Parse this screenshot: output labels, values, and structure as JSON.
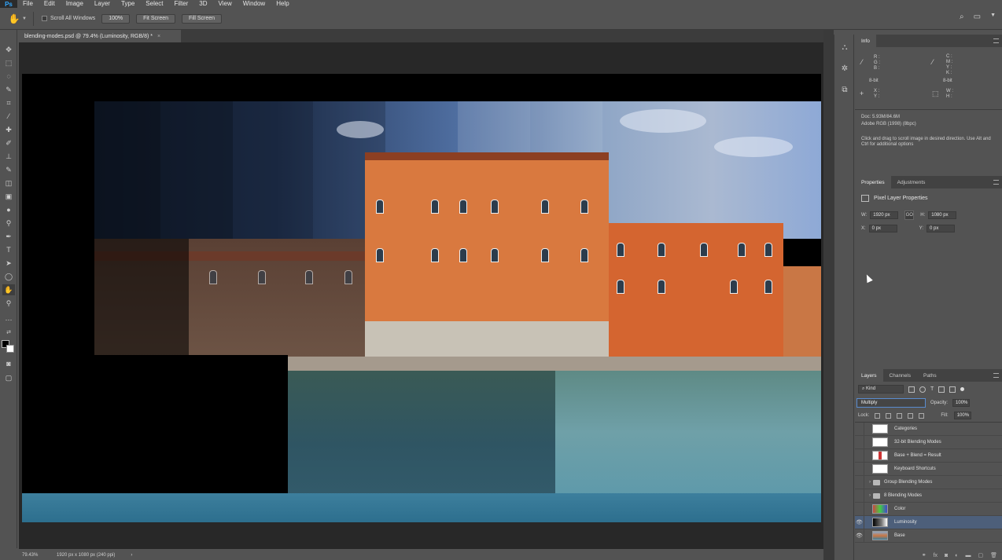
{
  "app": {
    "logo": "Ps"
  },
  "menu": [
    "File",
    "Edit",
    "Image",
    "Layer",
    "Type",
    "Select",
    "Filter",
    "3D",
    "View",
    "Window",
    "Help"
  ],
  "options": {
    "scroll_all": "Scroll All Windows",
    "zoom_100": "100%",
    "fit_screen": "Fit Screen",
    "fill_screen": "Fill Screen"
  },
  "document_tab": {
    "title": "blending-modes.psd @ 79.4% (Luminosity, RGB/8) *",
    "close": "×"
  },
  "status": {
    "zoom": "79.43%",
    "info": "1920 px x 1080 px (240 ppi)",
    "arrow": "›"
  },
  "info_panel": {
    "tab": "Info",
    "rgb_labels": "R :\nG :\nB :",
    "rgb_bits": "8-bit",
    "cmyk_labels": "C :\nM :\nY :\nK :",
    "cmyk_bits": "8-bit",
    "xy_labels": "X :\nY :",
    "wh_labels": "W :\nH :",
    "doc": "Doc: 5.93M/84.6M",
    "profile": "Adobe RGB (1998) (8bpc)",
    "hint": "Click and drag to scroll image in desired direction.  Use Alt and Ctrl for additional options"
  },
  "properties_panel": {
    "tabs": [
      "Properties",
      "Adjustments"
    ],
    "title": "Pixel Layer Properties",
    "w_label": "W:",
    "w_value": "1920 px",
    "link": "GO",
    "h_label": "H:",
    "h_value": "1080 px",
    "x_label": "X:",
    "x_value": "0 px",
    "y_label": "Y:",
    "y_value": "0 px"
  },
  "layers_panel": {
    "tabs": [
      "Layers",
      "Channels",
      "Paths"
    ],
    "kind": "⌕ Kind",
    "blend_mode": "Multiply",
    "opacity_label": "Opacity:",
    "opacity": "100%",
    "lock_label": "Lock:",
    "fill_label": "Fill:",
    "fill": "100%",
    "layers": [
      {
        "name": "Categories",
        "type": "layer",
        "visible": false
      },
      {
        "name": "32-bit Blending Modes",
        "type": "layer",
        "visible": false
      },
      {
        "name": "Base + Blend = Result",
        "type": "layer",
        "visible": false
      },
      {
        "name": "Keyboard Shortcuts",
        "type": "layer",
        "visible": false
      },
      {
        "name": "Group Blending Modes",
        "type": "group",
        "visible": false
      },
      {
        "name": "8 Blending Modes",
        "type": "group",
        "visible": false
      },
      {
        "name": "Color",
        "type": "layer",
        "visible": false
      },
      {
        "name": "Luminosity",
        "type": "layer",
        "visible": true,
        "selected": true
      },
      {
        "name": "Base",
        "type": "layer",
        "visible": true
      }
    ]
  },
  "colors": {
    "accent": "#31a8ff",
    "selected_layer": "#4d5f7a",
    "panel_bg": "#535353",
    "canvas_bg": "#282828"
  }
}
